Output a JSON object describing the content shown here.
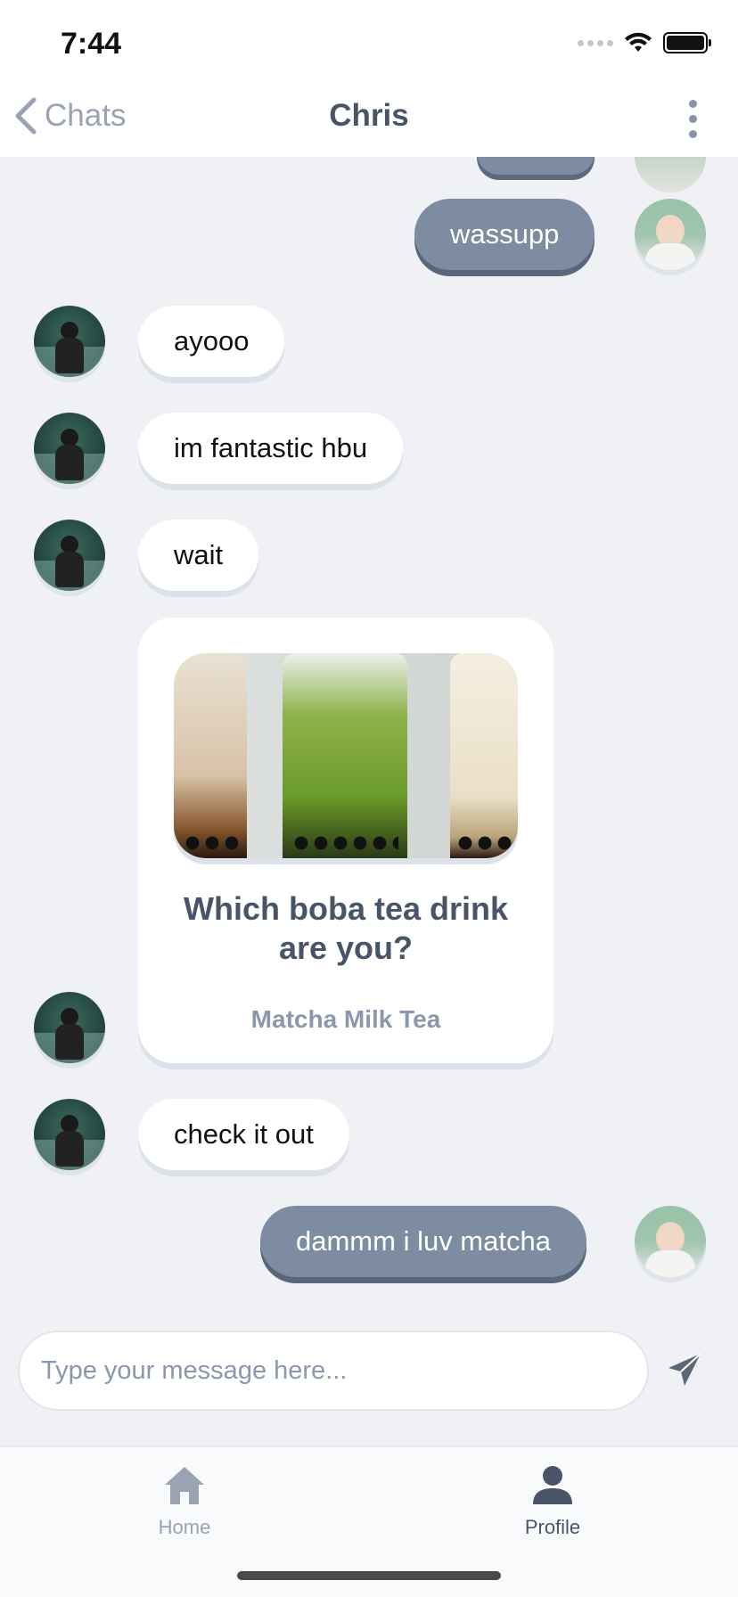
{
  "status_bar": {
    "time": "7:44"
  },
  "header": {
    "back_label": "Chats",
    "title": "Chris"
  },
  "messages": [
    {
      "text": "wassupp",
      "direction": "outgoing"
    },
    {
      "text": "ayooo",
      "direction": "incoming"
    },
    {
      "text": "im fantastic hbu",
      "direction": "incoming"
    },
    {
      "text": "wait",
      "direction": "incoming"
    },
    {
      "text": "check it out",
      "direction": "incoming"
    },
    {
      "text": "dammm i luv matcha",
      "direction": "outgoing"
    }
  ],
  "card": {
    "title": "Which boba tea drink are you?",
    "subtitle": "Matcha Milk Tea"
  },
  "composer": {
    "placeholder": "Type your message here..."
  },
  "tabbar": {
    "home_label": "Home",
    "profile_label": "Profile",
    "active": "Profile"
  },
  "colors": {
    "outgoing_bubble": "#7e8ca1",
    "incoming_bubble": "#ffffff",
    "background": "#eff1f5",
    "title_text": "#4a5468"
  }
}
